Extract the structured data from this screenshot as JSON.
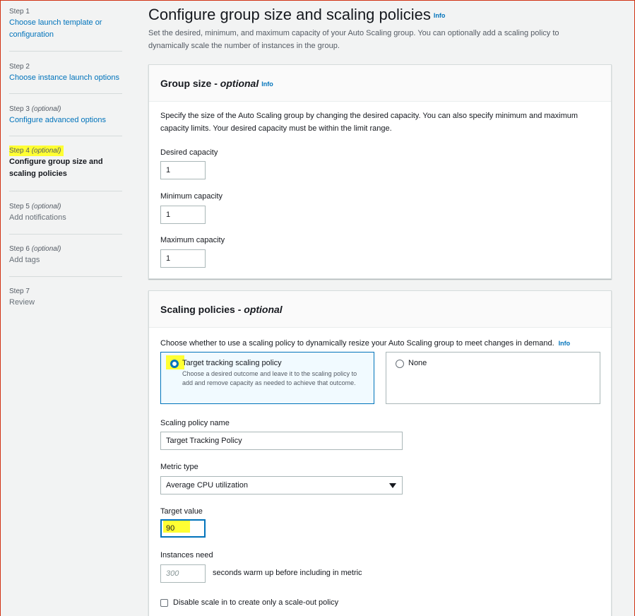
{
  "sidebar": {
    "steps": [
      {
        "num": "Step 1",
        "optional": "",
        "title": "Choose launch template or configuration"
      },
      {
        "num": "Step 2",
        "optional": "",
        "title": "Choose instance launch options"
      },
      {
        "num": "Step 3",
        "optional": "(optional)",
        "title": "Configure advanced options"
      },
      {
        "num": "Step 4",
        "optional": "(optional)",
        "title": "Configure group size and scaling policies"
      },
      {
        "num": "Step 5",
        "optional": "(optional)",
        "title": "Add notifications"
      },
      {
        "num": "Step 6",
        "optional": "(optional)",
        "title": "Add tags"
      },
      {
        "num": "Step 7",
        "optional": "",
        "title": "Review"
      }
    ]
  },
  "header": {
    "title": "Configure group size and scaling policies",
    "info": "Info",
    "description": "Set the desired, minimum, and maximum capacity of your Auto Scaling group. You can optionally add a scaling policy to dynamically scale the number of instances in the group."
  },
  "group_size": {
    "title": "Group size - ",
    "title_optional": "optional",
    "info": "Info",
    "description": "Specify the size of the Auto Scaling group by changing the desired capacity. You can also specify minimum and maximum capacity limits. Your desired capacity must be within the limit range.",
    "desired_label": "Desired capacity",
    "desired_value": "1",
    "minimum_label": "Minimum capacity",
    "minimum_value": "1",
    "maximum_label": "Maximum capacity",
    "maximum_value": "1"
  },
  "scaling": {
    "title": "Scaling policies - ",
    "title_optional": "optional",
    "description": "Choose whether to use a scaling policy to dynamically resize your Auto Scaling group to meet changes in demand.",
    "info": "Info",
    "option_target_title": "Target tracking scaling policy",
    "option_target_desc": "Choose a desired outcome and leave it to the scaling policy to add and remove capacity as needed to achieve that outcome.",
    "option_none_title": "None",
    "policy_name_label": "Scaling policy name",
    "policy_name_value": "Target Tracking Policy",
    "metric_type_label": "Metric type",
    "metric_type_value": "Average CPU utilization",
    "target_value_label": "Target value",
    "target_value": "90",
    "instances_need_label": "Instances need",
    "warmup_placeholder": "300",
    "warmup_suffix": "seconds warm up before including in metric",
    "disable_scale_in_label": "Disable scale in to create only a scale-out policy"
  },
  "colors": {
    "link": "#0073bb",
    "highlight": "#ffff33",
    "border_accent": "#d13212"
  }
}
